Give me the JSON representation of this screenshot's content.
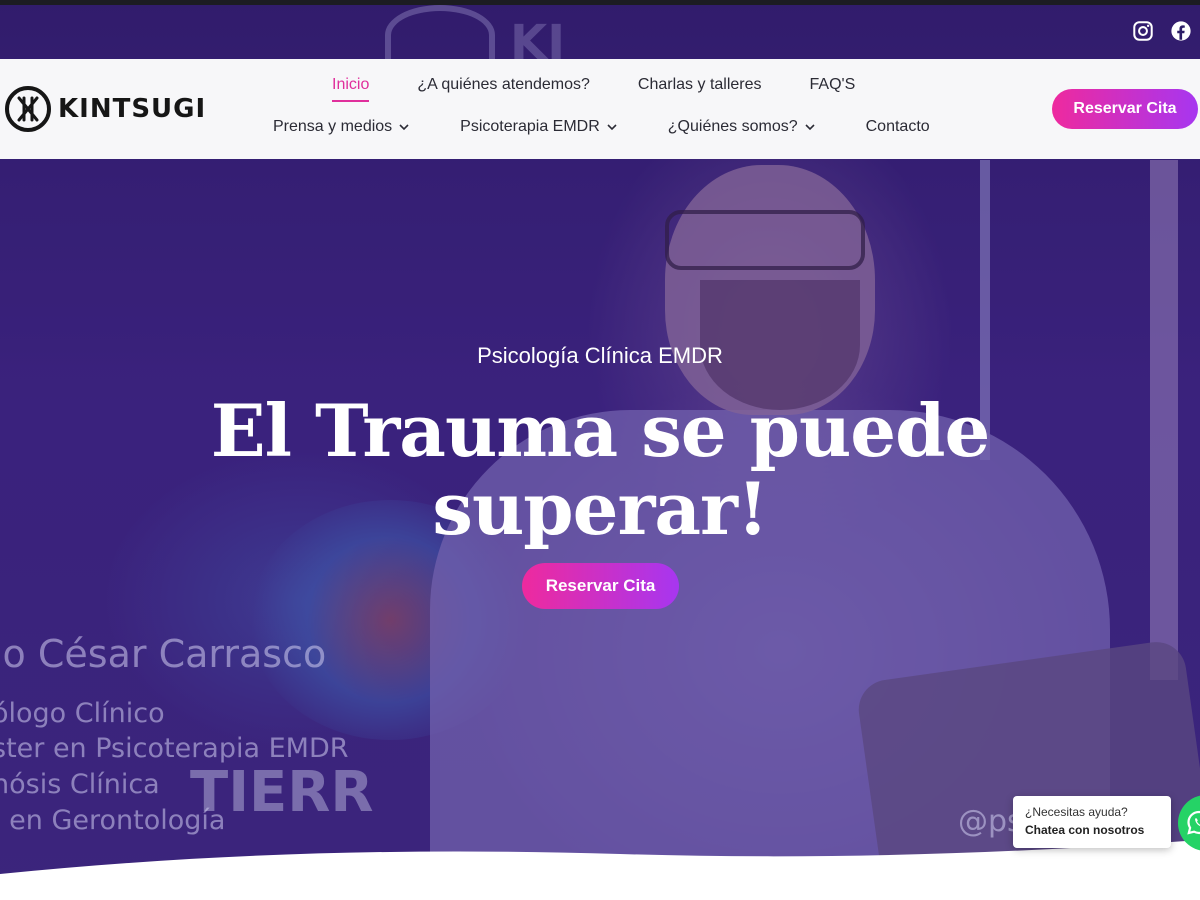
{
  "social": {
    "icons": [
      "instagram-icon",
      "facebook-icon"
    ]
  },
  "brand": {
    "name": "KINTSUGI"
  },
  "nav": {
    "row1": [
      {
        "label": "Inicio",
        "active": true
      },
      {
        "label": "¿A quiénes atendemos?"
      },
      {
        "label": "Charlas y talleres"
      },
      {
        "label": "FAQ'S"
      }
    ],
    "row2": [
      {
        "label": "Prensa y medios",
        "dropdown": true
      },
      {
        "label": "Psicoterapia EMDR",
        "dropdown": true
      },
      {
        "label": "¿Quiénes somos?",
        "dropdown": true
      },
      {
        "label": "Contacto"
      }
    ],
    "cta": "Reservar Cita"
  },
  "hero": {
    "eyebrow": "Psicología Clínica EMDR",
    "headline": "El Trauma se puede superar!",
    "cta": "Reservar Cita",
    "background_text": {
      "name": "io César Carrasco",
      "role1": "ólogo Clínico",
      "role2": "ster en Psicoterapia EMDR",
      "role3": "nósis Clínica",
      "role4": ". en Gerontología",
      "sign": "TIERR",
      "handle": "@ps",
      "logo_fragment": "KI"
    }
  },
  "chat": {
    "line1": "¿Necesitas ayuda?",
    "line2": "Chatea con nosotros"
  },
  "colors": {
    "accent_pink": "#ee2a9e",
    "accent_purple": "#a736f0",
    "active_nav": "#e02f9c",
    "header_bg": "#f7f7f9",
    "whatsapp": "#25d366"
  }
}
